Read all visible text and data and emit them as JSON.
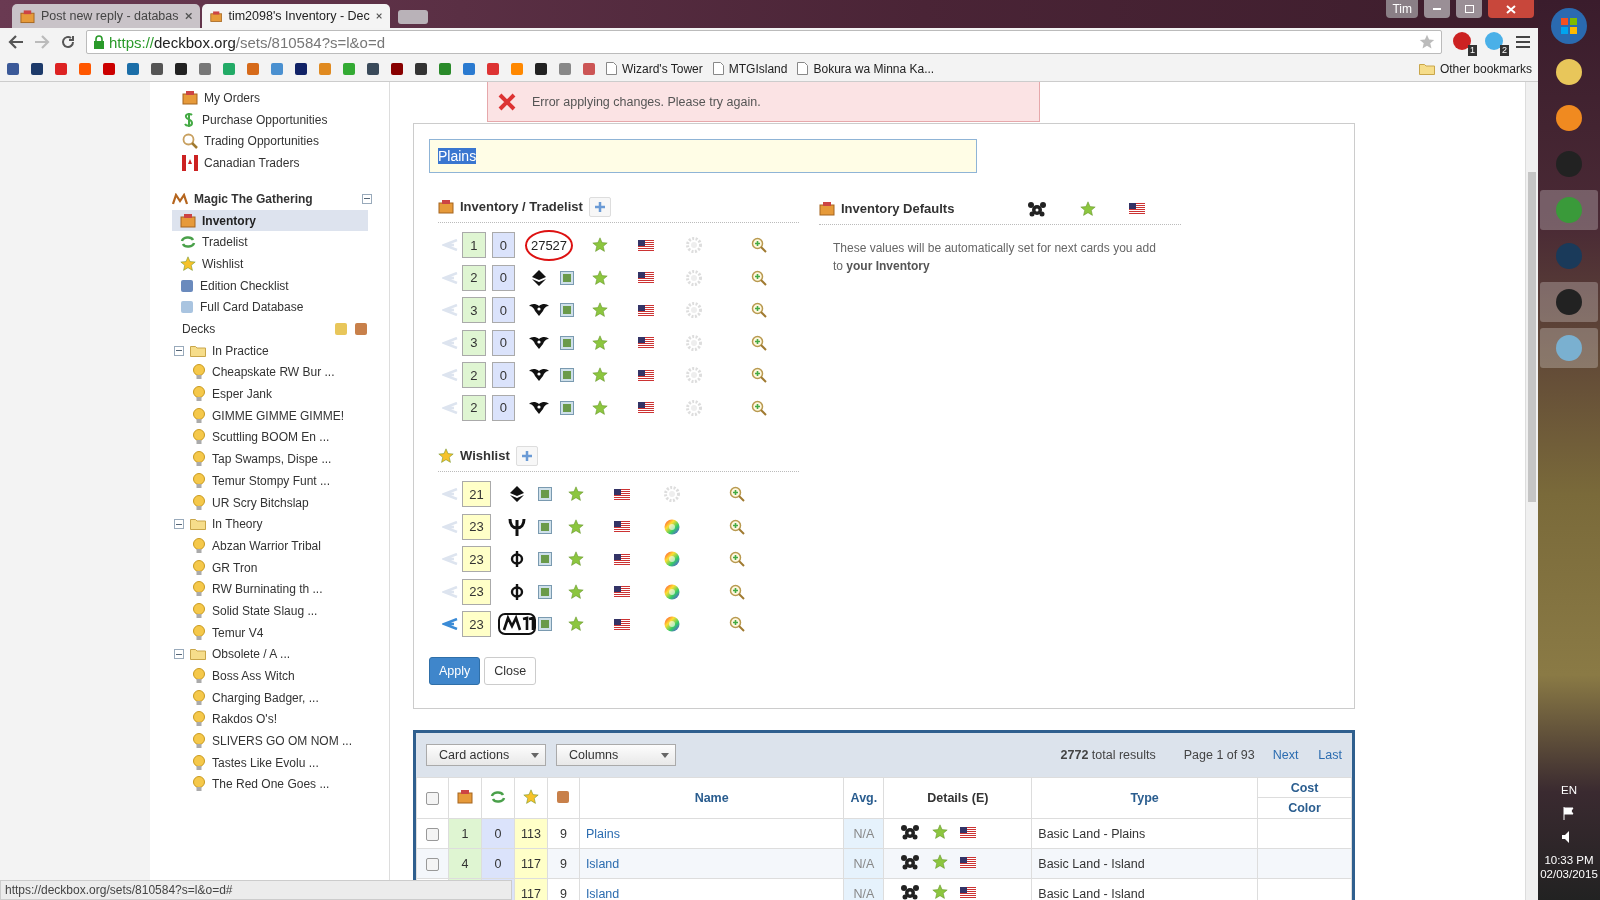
{
  "browser": {
    "tabs": [
      {
        "title": "Post new reply - databas",
        "selected": false
      },
      {
        "title": "tim2098's Inventory - Dec",
        "selected": true
      }
    ],
    "user": "Tim",
    "url": {
      "scheme": "https://",
      "host": "deckbox.org",
      "path": "/sets/810584?s=l&o=d"
    },
    "extension_badges": [
      "1",
      "2"
    ],
    "bookmarks": [
      {
        "label": "Wizard's Tower"
      },
      {
        "label": "MTGIsland"
      },
      {
        "label": "Bokura wa Minna Ka..."
      }
    ],
    "other_bookmarks": "Other bookmarks",
    "status_url": "https://deckbox.org/sets/810584?s=l&o=d#"
  },
  "sidebar": {
    "top_links": [
      "My Orders",
      "Purchase Opportunities",
      "Trading Opportunities",
      "Canadian Traders"
    ],
    "section": {
      "title": "Magic The Gathering",
      "expanded": true
    },
    "items": [
      {
        "label": "Inventory",
        "selected": true
      },
      {
        "label": "Tradelist",
        "selected": false
      },
      {
        "label": "Wishlist",
        "selected": false
      },
      {
        "label": "Edition Checklist",
        "selected": false
      },
      {
        "label": "Full Card Database",
        "selected": false
      }
    ],
    "decks_label": "Decks",
    "folders": [
      {
        "name": "In Practice",
        "expanded": true,
        "children": [
          "Cheapskate RW Bur ...",
          "Esper Jank",
          "GIMME GIMME GIMME!",
          "Scuttling BOOM En ...",
          "Tap Swamps, Dispe ...",
          "Temur Stompy Funt ...",
          "UR Scry Bitchslap"
        ]
      },
      {
        "name": "In Theory",
        "expanded": true,
        "children": [
          "Abzan Warrior Tribal",
          "GR Tron",
          "RW Burninating th ...",
          "Solid State Slaug ...",
          "Temur V4"
        ]
      },
      {
        "name": "Obsolete / A ...",
        "expanded": true,
        "children": [
          "Boss Ass Witch",
          "Charging Badger, ...",
          "Rakdos O's!",
          "SLIVERS GO OM NOM ...",
          "Tastes Like Evolu ...",
          "The Red One Goes ..."
        ]
      }
    ]
  },
  "error": "Error applying changes. Please try again.",
  "editor": {
    "card_name": "Plains",
    "inventory_title": "Inventory / Tradelist",
    "inventory_rows": [
      {
        "count": "1",
        "trade": "0",
        "kind": "number",
        "edition": "27527"
      },
      {
        "count": "2",
        "trade": "0",
        "kind": "diamond"
      },
      {
        "count": "3",
        "trade": "0",
        "kind": "wings"
      },
      {
        "count": "3",
        "trade": "0",
        "kind": "wings"
      },
      {
        "count": "2",
        "trade": "0",
        "kind": "wings"
      },
      {
        "count": "2",
        "trade": "0",
        "kind": "wings"
      }
    ],
    "wishlist_title": "Wishlist",
    "wishlist_rows": [
      {
        "count": "21",
        "kind": "diamond",
        "rainbow": false,
        "active": false
      },
      {
        "count": "23",
        "kind": "trident",
        "rainbow": true,
        "active": false
      },
      {
        "count": "23",
        "kind": "phi",
        "rainbow": true,
        "active": false
      },
      {
        "count": "23",
        "kind": "phi",
        "rainbow": true,
        "active": false
      },
      {
        "count": "23",
        "kind": "m11",
        "rainbow": true,
        "active": true
      }
    ],
    "defaults_title": "Inventory Defaults",
    "defaults_text": "These values will be automatically set for next cards you add to **your Inventory**",
    "buttons": [
      "Apply",
      "Close"
    ]
  },
  "table": {
    "select_all_checked": false,
    "actions": [
      "Card actions",
      "Columns"
    ],
    "results": "**2772** total results",
    "page": "Page 1 of 93",
    "nav": [
      "Next",
      "Last"
    ],
    "columns": [
      "Name",
      "Avg.",
      "Details (E)",
      "Type"
    ],
    "cost_color": [
      "Cost",
      "Color"
    ],
    "rows": [
      {
        "checked": false,
        "inventory": "1",
        "trade": "0",
        "wish": "113",
        "count": "9",
        "name": "Plains",
        "avg": "N/A",
        "type": "Basic Land - Plains"
      },
      {
        "checked": false,
        "inventory": "4",
        "trade": "0",
        "wish": "117",
        "count": "9",
        "name": "Island",
        "avg": "N/A",
        "type": "Basic Land - Island"
      },
      {
        "wish": "117",
        "count": "9",
        "name": "Island",
        "avg": "N/A",
        "type": "Basic Land - Island"
      }
    ]
  },
  "taskbar": {
    "language": "EN",
    "time": "10:33 PM",
    "date": "02/03/2015"
  }
}
